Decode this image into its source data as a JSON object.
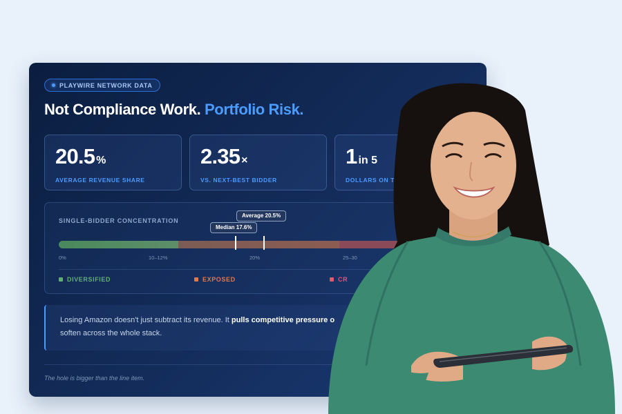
{
  "card": {
    "badge": "PLAYWIRE NETWORK DATA",
    "headline": "Not Compliance Work.",
    "headline_accent": "Portfolio Risk.",
    "stats": [
      {
        "value": "20.5",
        "unit": "%",
        "label": "AVERAGE REVENUE SHARE"
      },
      {
        "value": "2.35",
        "unit": "×",
        "label": "VS. NEXT-BEST BIDDER"
      },
      {
        "value": "1",
        "unit": "in 5",
        "label": "DOLLARS ON THE"
      }
    ],
    "concentration": {
      "title": "SINGLE-BIDDER CONCENTRATION",
      "median_label": "Median 17.6%",
      "average_label": "Average 20.5%",
      "median": 17.6,
      "average": 20.5,
      "ticks": [
        "0%",
        "10–12%",
        "20%",
        "25–30"
      ],
      "legend": [
        {
          "label": "DIVERSIFIED",
          "color": "#5fb072"
        },
        {
          "label": "EXPOSED",
          "color": "#e07a4e"
        },
        {
          "label": "CR",
          "color": "#e05a70"
        }
      ]
    },
    "quote": {
      "before": "Losing Amazon doesn't just subtract its revenue. It ",
      "bold": "pulls competitive pressure o",
      "line2": "soften across the whole stack."
    },
    "footnote": "The hole is bigger than the line item."
  }
}
